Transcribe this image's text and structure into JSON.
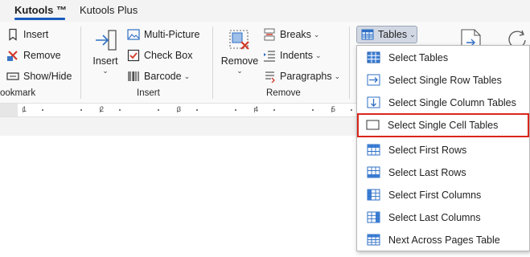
{
  "tabs": {
    "active": "Kutools ™",
    "other": "Kutools Plus"
  },
  "ribbon": {
    "bookmark": {
      "insert_label": "Insert",
      "remove_label": "Remove",
      "showhide_label": "Show/Hide",
      "group_label": "ookmark"
    },
    "insert_group": {
      "insert_label": "Insert",
      "multipicture_label": "Multi-Picture",
      "checkbox_label": "Check Box",
      "barcode_label": "Barcode",
      "group_label": "Insert"
    },
    "remove_group": {
      "remove_label": "Remove",
      "breaks_label": "Breaks",
      "indents_label": "Indents",
      "paragraphs_label": "Paragraphs",
      "group_label": "Remove"
    },
    "tables_label": "Tables"
  },
  "ruler": {
    "numbers": [
      "1",
      "2",
      "3",
      "4",
      "5"
    ]
  },
  "menu": {
    "items": [
      {
        "label": "Select Tables",
        "icon": "select-tables-icon"
      },
      {
        "label": "Select Single Row Tables",
        "icon": "single-row-tables-icon"
      },
      {
        "label": "Select Single Column Tables",
        "icon": "single-column-tables-icon"
      },
      {
        "label": "Select Single Cell Tables",
        "icon": "single-cell-tables-icon"
      },
      {
        "label": "Select First Rows",
        "icon": "first-rows-icon"
      },
      {
        "label": "Select Last Rows",
        "icon": "last-rows-icon"
      },
      {
        "label": "Select First Columns",
        "icon": "first-columns-icon"
      },
      {
        "label": "Select Last Columns",
        "icon": "last-columns-icon"
      },
      {
        "label": "Next Across Pages Table",
        "icon": "across-pages-table-icon"
      }
    ],
    "highlighted_index": 3
  },
  "colors": {
    "accent": "#185abd",
    "highlight_border": "#d9261c",
    "table_blue": "#2f6fc5"
  }
}
